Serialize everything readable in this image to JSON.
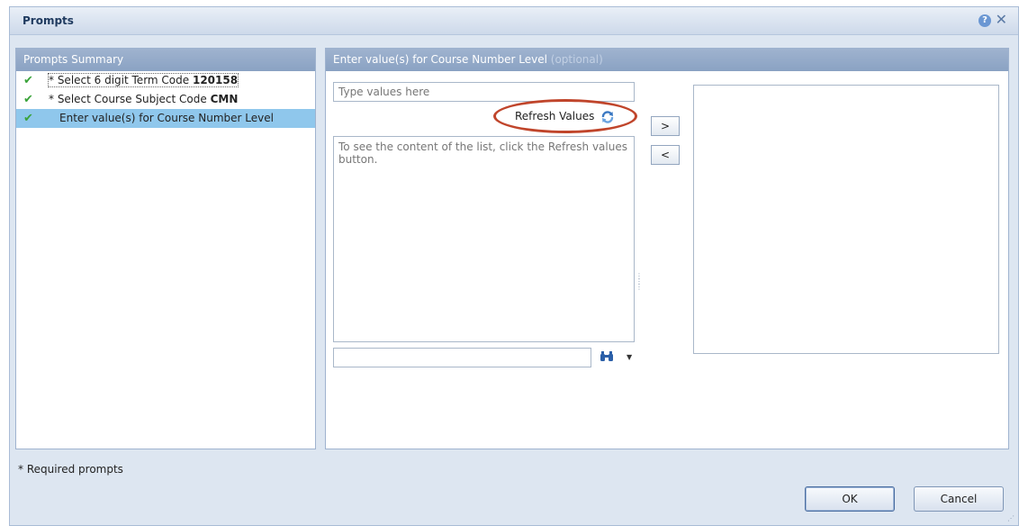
{
  "dialog": {
    "title": "Prompts",
    "help_icon": "help-icon",
    "close_icon": "close-icon"
  },
  "summary": {
    "header": "Prompts Summary",
    "items": [
      {
        "label": "* Select 6 digit Term Code ",
        "value": "120158",
        "status": "check-icon",
        "selected": false
      },
      {
        "label": "* Select Course Subject Code ",
        "value": "CMN",
        "status": "check-icon",
        "selected": false
      },
      {
        "label": "Enter value(s) for Course Number Level",
        "value": "",
        "status": "check-icon",
        "selected": true
      }
    ]
  },
  "entry": {
    "header": "Enter value(s) for Course Number Level",
    "header_optional": "(optional)",
    "type_placeholder": "Type values here",
    "refresh_label": "Refresh Values",
    "list_hint": "To see the content of the list, click the Refresh values button.",
    "add_label": ">",
    "remove_label": "<"
  },
  "footer": {
    "required_note": "* Required prompts",
    "ok_label": "OK",
    "cancel_label": "Cancel"
  },
  "colors": {
    "accent": "#8aa2c3",
    "selected_row": "#8fc7ec",
    "highlight_oval": "#c0452b",
    "check": "#3aa33a"
  }
}
